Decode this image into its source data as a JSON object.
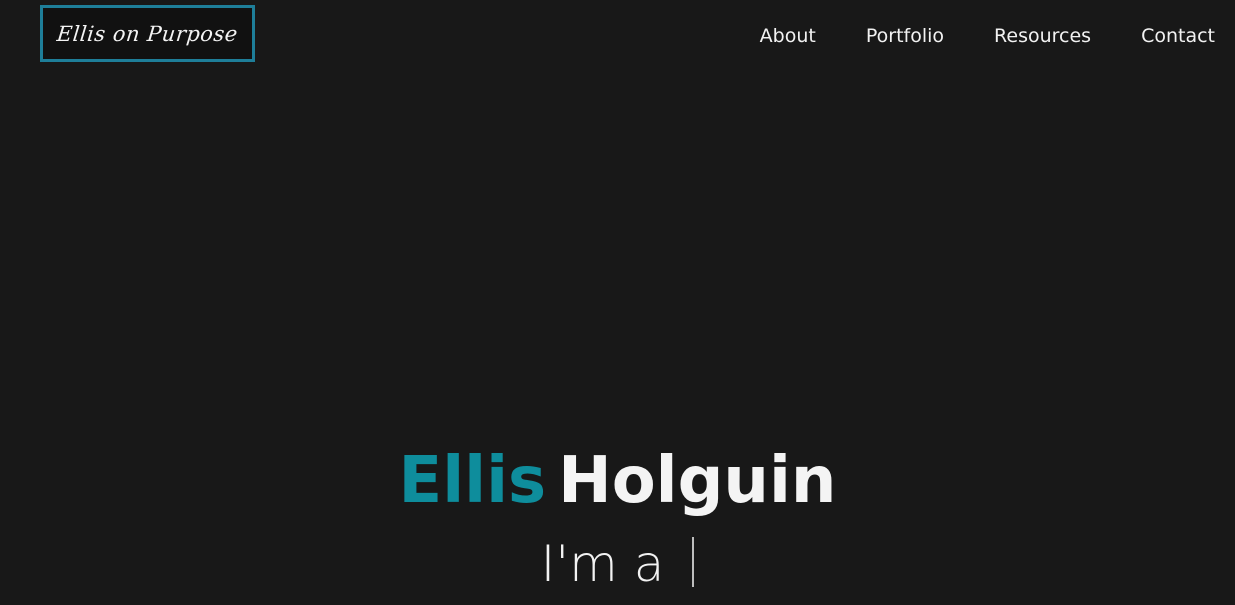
{
  "header": {
    "logo_text": "Ellis on Purpose",
    "nav": [
      {
        "label": "About"
      },
      {
        "label": "Portfolio"
      },
      {
        "label": "Resources"
      },
      {
        "label": "Contact"
      }
    ]
  },
  "hero": {
    "first_name": "Ellis",
    "last_name": "Holguin",
    "tagline": "I'm a"
  },
  "colors": {
    "background": "#181818",
    "accent": "#0e8d9c",
    "logo_border": "#1e7e99",
    "text": "#f2f2f2"
  }
}
